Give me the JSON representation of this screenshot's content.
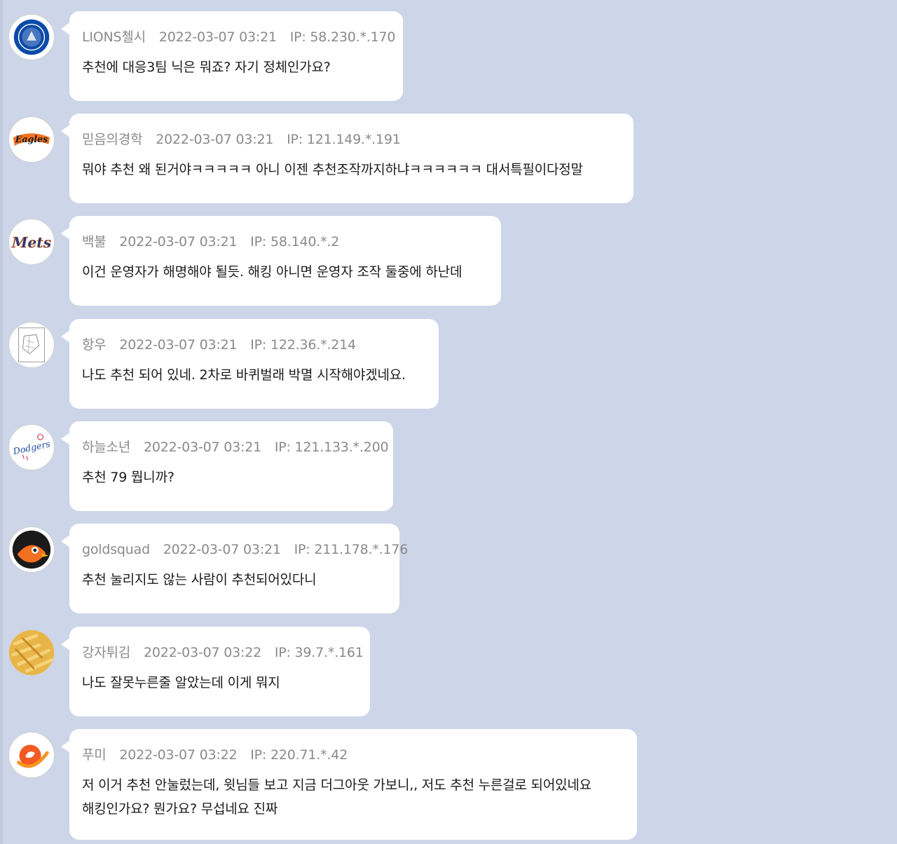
{
  "comments": [
    {
      "author": "LIONS첼시",
      "datetime": "2022-03-07 03:21",
      "ip": "IP: 58.230.*.170",
      "text": "추천에 대응3팀 닉은 뭐죠? 자기 정체인가요?",
      "avatar": "chelsea-crest-icon"
    },
    {
      "author": "믿음의경학",
      "datetime": "2022-03-07 03:21",
      "ip": "IP: 121.149.*.191",
      "text": "뭐야 추천 왜 된거야ㅋㅋㅋㅋㅋ 아니 이젠 추천조작까지하냐ㅋㅋㅋㅋㅋㅋ 대서특필이다정말",
      "avatar": "hanwha-eagles-logo-icon",
      "avatar_text": "Eagles"
    },
    {
      "author": "백불",
      "datetime": "2022-03-07 03:21",
      "ip": "IP: 58.140.*.2",
      "text": "이건 운영자가 해명해야 될듯. 해킹 아니면 운영자 조작 둘중에 하난데",
      "avatar": "mets-logo-icon",
      "avatar_text": "Mets"
    },
    {
      "author": "항우",
      "datetime": "2022-03-07 03:21",
      "ip": "IP: 122.36.*.214",
      "text": "나도 추천 되어 있네. 2차로 바퀴벌래 박멸 시작해야겠네요.",
      "avatar": "sketch-drawing-icon"
    },
    {
      "author": "하늘소년",
      "datetime": "2022-03-07 03:21",
      "ip": "IP: 121.133.*.200",
      "text": "추천 79 뭡니까?",
      "avatar": "dodgers-logo-icon",
      "avatar_text": "Dodgers"
    },
    {
      "author": "goldsquad",
      "datetime": "2022-03-07 03:21",
      "ip": "IP: 211.178.*.176",
      "text": "추천 눌리지도 않는 사람이 추천되어있다니",
      "avatar": "orioles-bird-icon"
    },
    {
      "author": "강자튀김",
      "datetime": "2022-03-07 03:22",
      "ip": "IP: 39.7.*.161",
      "text": "나도 잘못누른줄 알았는데 이게 뭐지",
      "avatar": "french-fries-icon"
    },
    {
      "author": "푸미",
      "datetime": "2022-03-07 03:22",
      "ip": "IP: 220.71.*.42",
      "text": "저 이거 추천 안눌렀는데, 윗님들 보고 지금 더그아웃 가보니,, 저도 추천 누른걸로 되어있네요",
      "text2": "해킹인가요? 뭔가요? 무섭네요 진짜",
      "avatar": "orange-swirl-logo-icon"
    }
  ],
  "colors": {
    "background": "#cdd6e8",
    "bubble": "#ffffff",
    "meta": "#8a8a8a",
    "text": "#1b1b1b"
  }
}
